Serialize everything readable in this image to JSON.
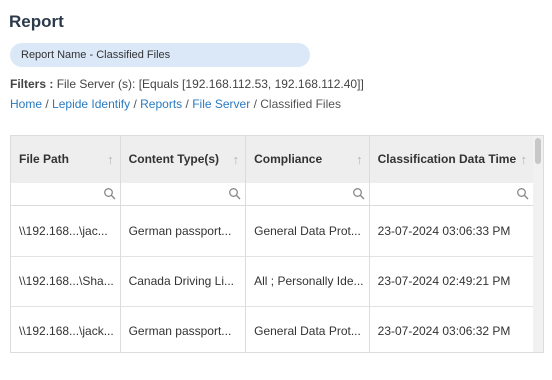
{
  "page": {
    "title": "Report"
  },
  "report_name": "Report Name - Classified Files",
  "filters": {
    "label": "Filters :",
    "value": "File Server (s): [Equals [192.168.112.53, 192.168.112.40]]"
  },
  "breadcrumb": {
    "items": [
      "Home",
      "Lepide Identify",
      "Reports",
      "File Server"
    ],
    "current": "Classified Files",
    "separator": "/"
  },
  "table": {
    "columns": [
      "File Path",
      "Content Type(s)",
      "Compliance",
      "Classification Data Time"
    ],
    "sort_icon": "sort-arrow-icon",
    "filter_icon": "search-icon",
    "rows": [
      [
        "\\\\192.168...\\jac...",
        "German passport...",
        "General Data Prot...",
        "23-07-2024 03:06:33 PM"
      ],
      [
        "\\\\192.168...\\Sha...",
        "Canada Driving Li...",
        "All ; Personally Ide...",
        "23-07-2024 02:49:21 PM"
      ],
      [
        "\\\\192.168...\\jack...",
        "German passport...",
        "General Data Prot...",
        "23-07-2024 03:06:32 PM"
      ]
    ]
  }
}
